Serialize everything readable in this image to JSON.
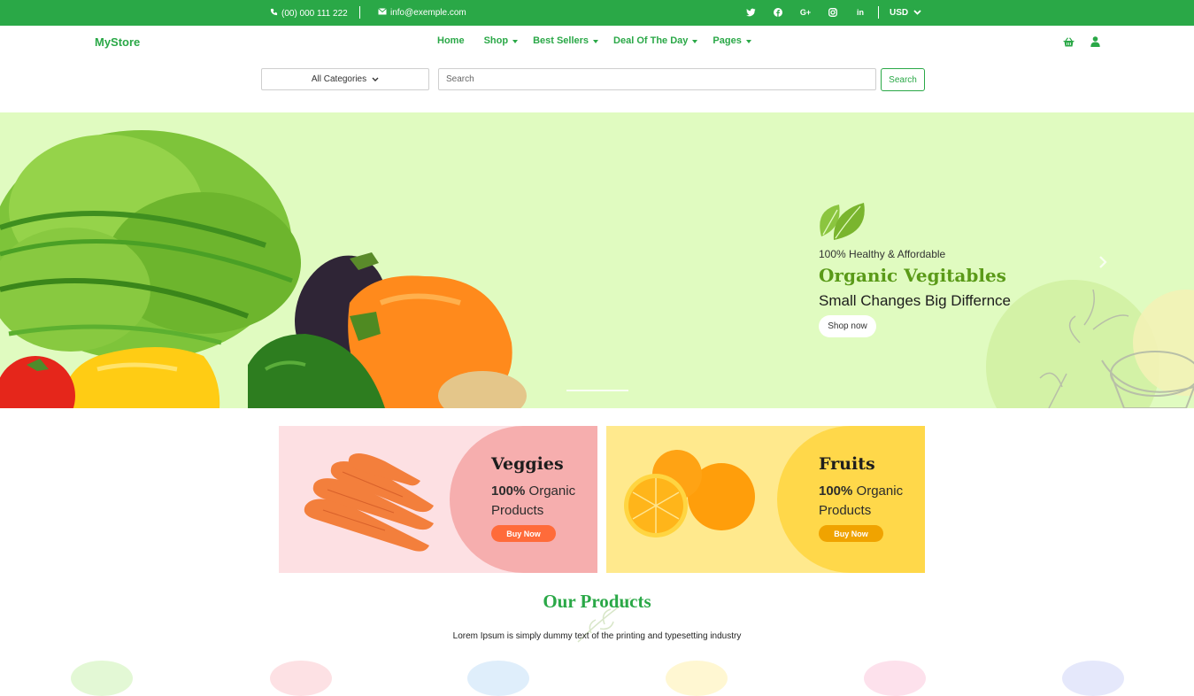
{
  "topbar": {
    "phone": "(00) 000 111 222",
    "email": "info@exemple.com",
    "social": [
      "twitter-icon",
      "facebook-icon",
      "google-plus-icon",
      "instagram-icon",
      "linkedin-icon"
    ],
    "social_labels": {
      "twitter": "t",
      "facebook": "f",
      "gplus": "G+",
      "instagram": "◎",
      "linkedin": "in"
    },
    "currency": "USD"
  },
  "header": {
    "logo": "MyStore",
    "nav": [
      {
        "label": "Home",
        "has_caret": false
      },
      {
        "label": "Shop",
        "has_caret": true
      },
      {
        "label": "Best Sellers",
        "has_caret": true
      },
      {
        "label": "Deal Of The Day",
        "has_caret": true
      },
      {
        "label": "Pages",
        "has_caret": true
      }
    ]
  },
  "search": {
    "category": "All Categories",
    "placeholder": "Search",
    "button": "Search"
  },
  "hero": {
    "kicker": "100% Healthy & Affordable",
    "title": "Organic Vegitables",
    "subtitle": "Small Changes Big Differnce",
    "button": "Shop now"
  },
  "promos": [
    {
      "title": "Veggies",
      "bold": "100%",
      "rest": " Organic Products",
      "button": "Buy Now"
    },
    {
      "title": "Fruits",
      "bold": "100%",
      "rest": " Organic Products",
      "button": "Buy Now"
    }
  ],
  "products": {
    "title": "Our Products",
    "subtitle": "Lorem Ipsum is simply dummy text of the printing and typesetting industry"
  },
  "colors": {
    "brand": "#2aa847",
    "hero_bg": "#e0fbc0",
    "veggies_bg": "#fde0e3",
    "fruits_bg": "#ffe98d"
  }
}
